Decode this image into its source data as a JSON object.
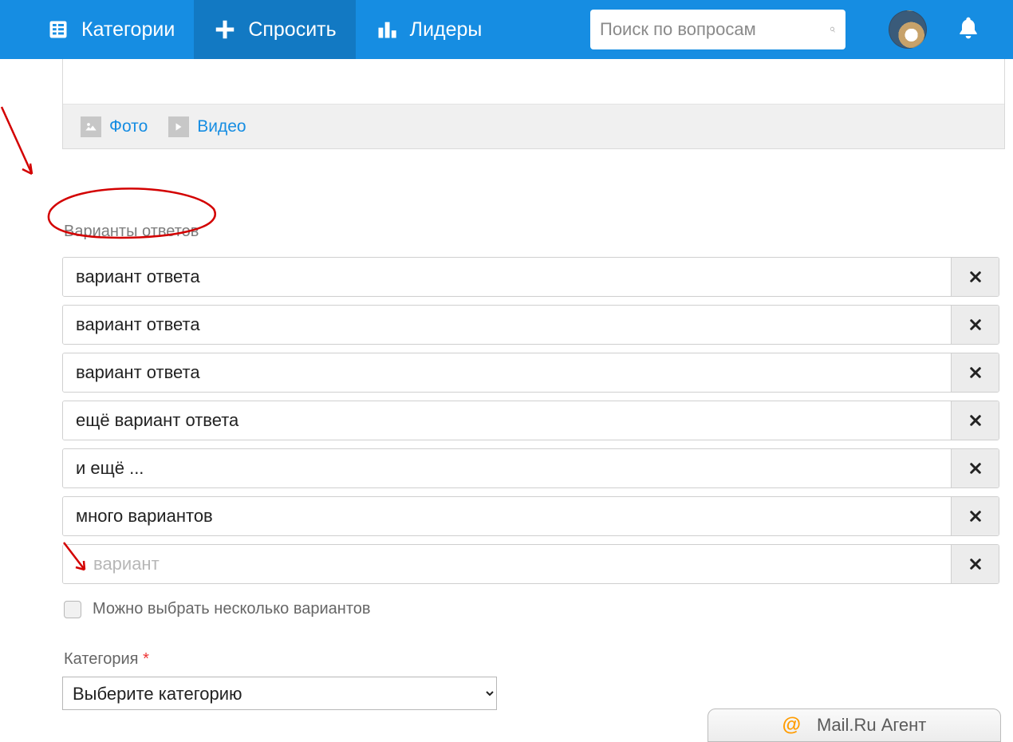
{
  "header": {
    "categories_label": "Категории",
    "ask_label": "Спросить",
    "leaders_label": "Лидеры"
  },
  "search": {
    "placeholder": "Поиск по вопросам"
  },
  "editor": {
    "photo_label": "Фото",
    "video_label": "Видео"
  },
  "poll": {
    "section_label": "Варианты ответов",
    "options": [
      "вариант ответа",
      "вариант ответа",
      "вариант ответа",
      "ещё вариант ответа",
      "и ещё ...",
      "много вариантов"
    ],
    "new_option_placeholder": "вариант",
    "allow_multiple_label": "Можно выбрать несколько вариантов"
  },
  "category": {
    "label": "Категория",
    "required_marker": "*",
    "select_placeholder": "Выберите категорию"
  },
  "agent": {
    "at": "@",
    "title": "Mail.Ru Агент"
  }
}
